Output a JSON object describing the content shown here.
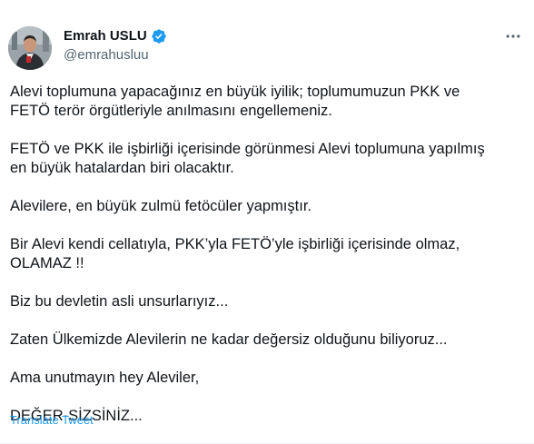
{
  "author": {
    "display_name": "Emrah USLU",
    "handle": "@emrahusluu",
    "verified_icon": "verified-badge-icon",
    "verified_color": "#1d9bf0"
  },
  "menu": {
    "icon": "more-horizontal-icon"
  },
  "tweet": {
    "paragraphs": [
      "Alevi toplumuna yapacağınız en büyük iyilik; toplumumuzun PKK ve\nFETÖ terör örgütleriyle anılmasını engellemeniz.",
      "FETÖ ve PKK ile işbirliği içerisinde görünmesi Alevi toplumuna yapılmış\nen büyük hatalardan biri olacaktır.",
      "Alevilere, en büyük zulmü fetöcüler yapmıştır.",
      "Bir Alevi kendi cellatıyla, PKK’yla FETÖ’yle işbirliği içerisinde olmaz,\nOLAMAZ !!",
      "Biz bu devletin asli unsurlarıyız...",
      "Zaten Ülkemizde Alevilerin ne kadar değersiz olduğunu biliyoruz...",
      "Ama unutmayın hey Aleviler,",
      "DEĞER-SİZSİNİZ..."
    ],
    "translate_label": "Translate Tweet"
  },
  "colors": {
    "text": "#0f1419",
    "secondary": "#536471",
    "link": "#1d9bf0"
  }
}
